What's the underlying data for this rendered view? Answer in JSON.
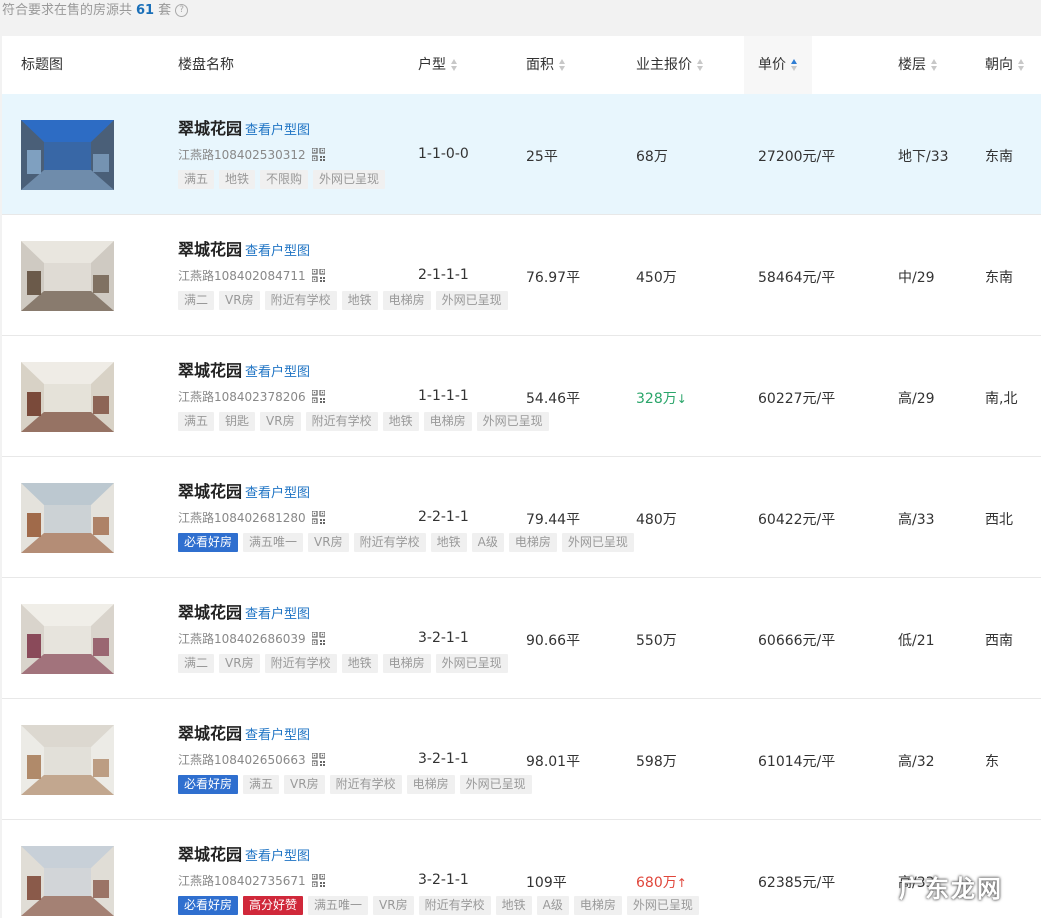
{
  "summary": {
    "prefix": "符合要求在售的房源共",
    "count": "61",
    "suffix": "套"
  },
  "headers": {
    "image": "标题图",
    "name": "楼盘名称",
    "layout": "户型",
    "area": "面积",
    "price": "业主报价",
    "unit_price": "单价",
    "floor": "楼层",
    "orientation": "朝向"
  },
  "plan_link": "查看户型图",
  "rows": [
    {
      "name": "翠城花园",
      "code": "江燕路108402530312",
      "tags": [
        {
          "t": "满五",
          "k": ""
        },
        {
          "t": "地铁",
          "k": ""
        },
        {
          "t": "不限购",
          "k": ""
        },
        {
          "t": "外网已呈现",
          "k": ""
        }
      ],
      "layout": "1-1-0-0",
      "area": "25平",
      "price": "68万",
      "price_trend": "",
      "unit_price": "27200元/平",
      "floor": "地下/33",
      "orientation": "东南"
    },
    {
      "name": "翠城花园",
      "code": "江燕路108402084711",
      "tags": [
        {
          "t": "满二",
          "k": ""
        },
        {
          "t": "VR房",
          "k": ""
        },
        {
          "t": "附近有学校",
          "k": ""
        },
        {
          "t": "地铁",
          "k": ""
        },
        {
          "t": "电梯房",
          "k": ""
        },
        {
          "t": "外网已呈现",
          "k": ""
        }
      ],
      "layout": "2-1-1-1",
      "area": "76.97平",
      "price": "450万",
      "price_trend": "",
      "unit_price": "58464元/平",
      "floor": "中/29",
      "orientation": "东南"
    },
    {
      "name": "翠城花园",
      "code": "江燕路108402378206",
      "tags": [
        {
          "t": "满五",
          "k": ""
        },
        {
          "t": "钥匙",
          "k": ""
        },
        {
          "t": "VR房",
          "k": ""
        },
        {
          "t": "附近有学校",
          "k": ""
        },
        {
          "t": "地铁",
          "k": ""
        },
        {
          "t": "电梯房",
          "k": ""
        },
        {
          "t": "外网已呈现",
          "k": ""
        }
      ],
      "layout": "1-1-1-1",
      "area": "54.46平",
      "price": "328万",
      "price_trend": "down",
      "unit_price": "60227元/平",
      "floor": "高/29",
      "orientation": "南,北"
    },
    {
      "name": "翠城花园",
      "code": "江燕路108402681280",
      "tags": [
        {
          "t": "必看好房",
          "k": "blue"
        },
        {
          "t": "满五唯一",
          "k": ""
        },
        {
          "t": "VR房",
          "k": ""
        },
        {
          "t": "附近有学校",
          "k": ""
        },
        {
          "t": "地铁",
          "k": ""
        },
        {
          "t": "A级",
          "k": ""
        },
        {
          "t": "电梯房",
          "k": ""
        },
        {
          "t": "外网已呈现",
          "k": ""
        }
      ],
      "layout": "2-2-1-1",
      "area": "79.44平",
      "price": "480万",
      "price_trend": "",
      "unit_price": "60422元/平",
      "floor": "高/33",
      "orientation": "西北"
    },
    {
      "name": "翠城花园",
      "code": "江燕路108402686039",
      "tags": [
        {
          "t": "满二",
          "k": ""
        },
        {
          "t": "VR房",
          "k": ""
        },
        {
          "t": "附近有学校",
          "k": ""
        },
        {
          "t": "地铁",
          "k": ""
        },
        {
          "t": "电梯房",
          "k": ""
        },
        {
          "t": "外网已呈现",
          "k": ""
        }
      ],
      "layout": "3-2-1-1",
      "area": "90.66平",
      "price": "550万",
      "price_trend": "",
      "unit_price": "60666元/平",
      "floor": "低/21",
      "orientation": "西南"
    },
    {
      "name": "翠城花园",
      "code": "江燕路108402650663",
      "tags": [
        {
          "t": "必看好房",
          "k": "blue"
        },
        {
          "t": "满五",
          "k": ""
        },
        {
          "t": "VR房",
          "k": ""
        },
        {
          "t": "附近有学校",
          "k": ""
        },
        {
          "t": "电梯房",
          "k": ""
        },
        {
          "t": "外网已呈现",
          "k": ""
        }
      ],
      "layout": "3-2-1-1",
      "area": "98.01平",
      "price": "598万",
      "price_trend": "",
      "unit_price": "61014元/平",
      "floor": "高/32",
      "orientation": "东"
    },
    {
      "name": "翠城花园",
      "code": "江燕路108402735671",
      "tags": [
        {
          "t": "必看好房",
          "k": "blue"
        },
        {
          "t": "高分好赞",
          "k": "red"
        },
        {
          "t": "满五唯一",
          "k": ""
        },
        {
          "t": "VR房",
          "k": ""
        },
        {
          "t": "附近有学校",
          "k": ""
        },
        {
          "t": "地铁",
          "k": ""
        },
        {
          "t": "A级",
          "k": ""
        },
        {
          "t": "电梯房",
          "k": ""
        },
        {
          "t": "外网已呈现",
          "k": ""
        }
      ],
      "layout": "3-2-1-1",
      "area": "109平",
      "price": "680万",
      "price_trend": "up",
      "unit_price": "62385元/平",
      "floor": "高/33",
      "orientation": ""
    }
  ],
  "watermark": "广东龙网",
  "colors": {
    "accent": "#1f74c4",
    "highlight_row": "#e8f6fd",
    "price_down": "#2aa56a",
    "price_up": "#e0463b",
    "tag_blue": "#2f6fcf",
    "tag_red": "#d0283a"
  }
}
